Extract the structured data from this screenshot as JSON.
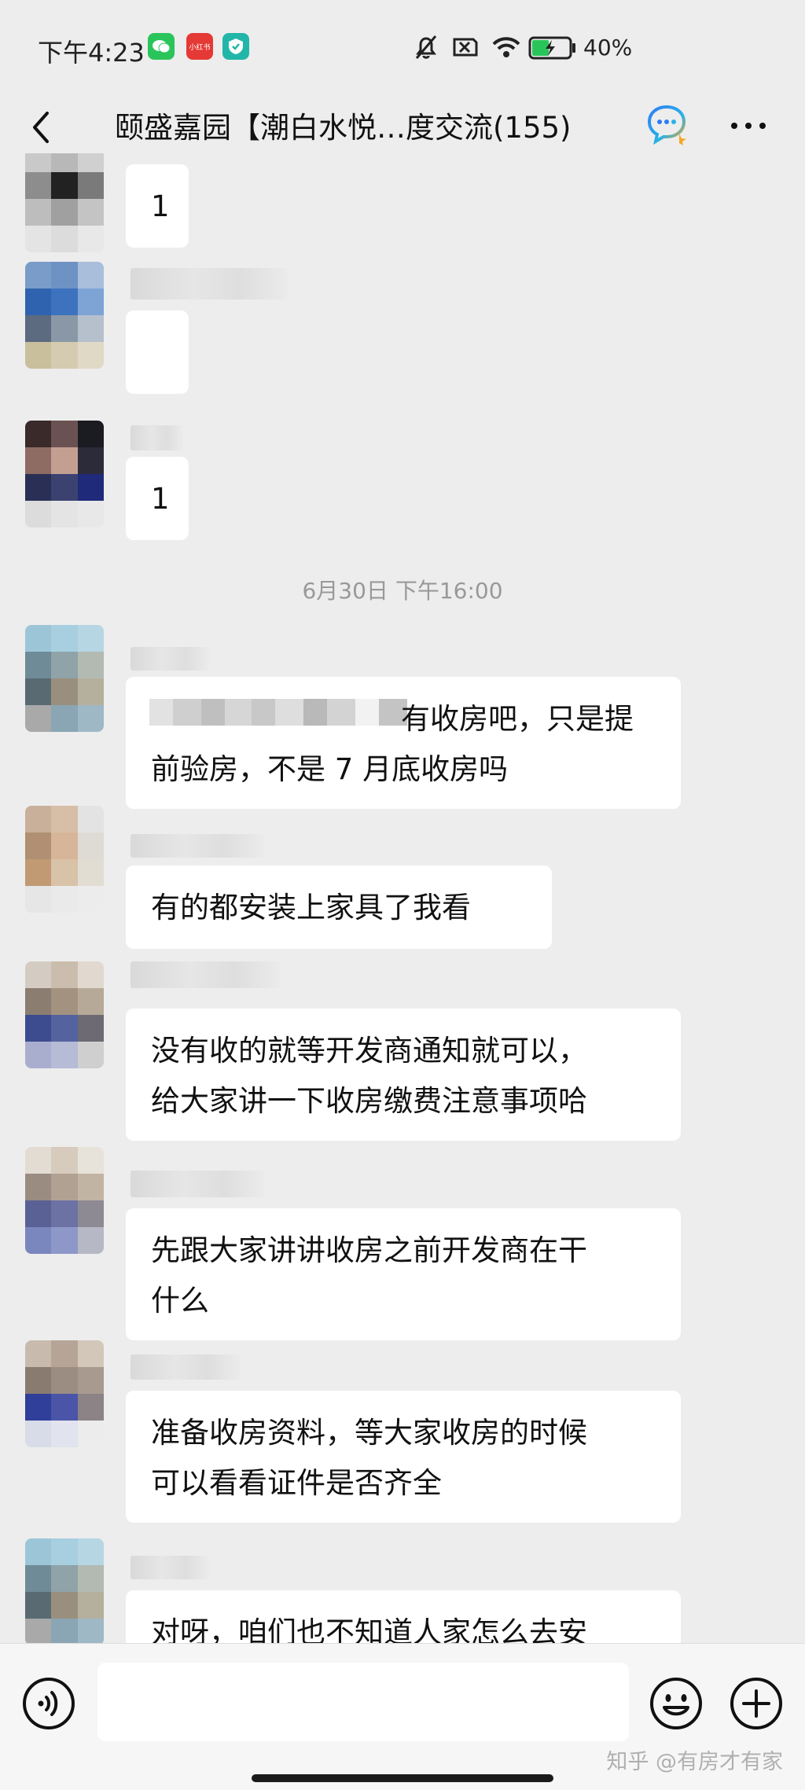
{
  "status_bar": {
    "time": "下午4:23",
    "xhs_label": "小红书",
    "battery": "40%"
  },
  "title_bar": {
    "title": "颐盛嘉园【潮白水悦…度交流(155)"
  },
  "messages": [
    {
      "text": "1"
    },
    {
      "text": ""
    },
    {
      "text": "1"
    },
    {
      "timestamp": "6月30日 下午16:00"
    },
    {
      "text": "有收房吧，只是提\n前验房，不是 7 月底收房吗"
    },
    {
      "text": "有的都安装上家具了我看"
    },
    {
      "text": "没有收的就等开发商通知就可以，\n给大家讲一下收房缴费注意事项哈"
    },
    {
      "text": "先跟大家讲讲收房之前开发商在干\n什么"
    },
    {
      "text": "准备收房资料，等大家收房的时候\n可以看看证件是否齐全"
    },
    {
      "text": "对呀，咱们也不知道人家怎么去安"
    }
  ],
  "input_bar": {
    "value": "",
    "watermark": "知乎 @有房才有家"
  },
  "icons": {
    "back": "back-arrow-icon",
    "group_chat": "chat-bubble-icon",
    "more": "more-dots-icon",
    "voice": "voice-icon",
    "emoji": "emoji-icon",
    "plus": "plus-icon"
  },
  "colors": {
    "background": "#ededed",
    "bubble": "#ffffff",
    "wechat_green": "#2ac55a"
  }
}
